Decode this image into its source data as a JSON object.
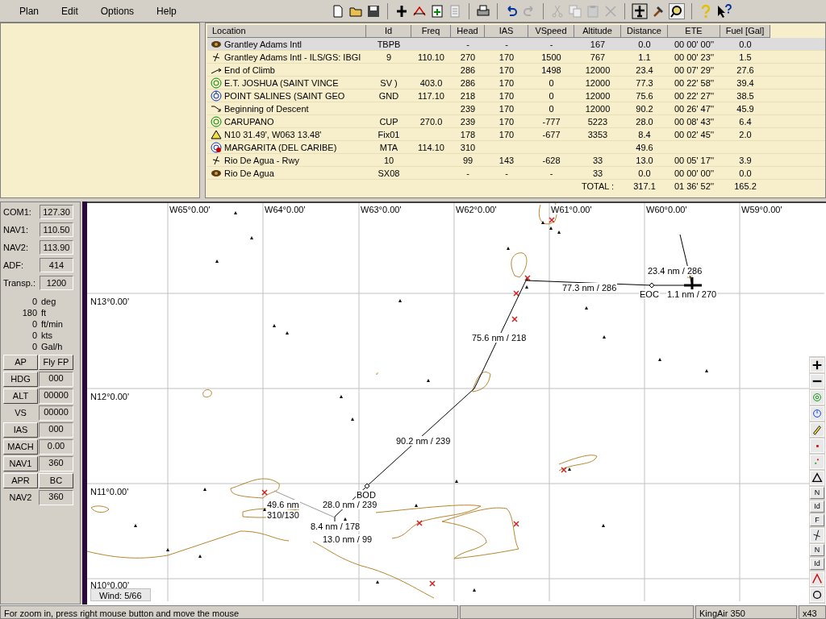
{
  "menu": [
    "Plan",
    "Edit",
    "Options",
    "Help"
  ],
  "flight_plan": {
    "columns": [
      "Location",
      "Id",
      "Freq",
      "Head",
      "IAS",
      "VSpeed",
      "Altitude",
      "Distance",
      "ETE",
      "Fuel [Gal]"
    ],
    "rows": [
      {
        "kind": "airport",
        "selected": true,
        "cells": [
          "Grantley Adams Intl",
          "TBPB",
          "",
          "-",
          "-",
          "-",
          "167",
          "0.0",
          "00 00' 00''",
          "0.0"
        ]
      },
      {
        "kind": "runway",
        "selected": false,
        "cells": [
          "Grantley Adams Intl - ILS/GS: IBGI",
          "9",
          "110.10",
          "270",
          "170",
          "1500",
          "767",
          "1.1",
          "00 00' 23''",
          "1.5"
        ]
      },
      {
        "kind": "climb",
        "selected": false,
        "cells": [
          "End of Climb",
          "",
          "",
          "286",
          "170",
          "1498",
          "12000",
          "23.4",
          "00 07' 29''",
          "27.6"
        ]
      },
      {
        "kind": "ndb",
        "selected": false,
        "cells": [
          "E.T. JOSHUA (SAINT VINCE",
          "SV )",
          "403.0",
          "286",
          "170",
          "0",
          "12000",
          "77.3",
          "00 22' 58''",
          "39.4"
        ]
      },
      {
        "kind": "vor",
        "selected": false,
        "cells": [
          "POINT SALINES (SAINT GEO",
          "GND",
          "117.10",
          "218",
          "170",
          "0",
          "12000",
          "75.6",
          "00 22' 27''",
          "38.5"
        ]
      },
      {
        "kind": "descent",
        "selected": false,
        "cells": [
          "Beginning of Descent",
          "",
          "",
          "239",
          "170",
          "0",
          "12000",
          "90.2",
          "00 26' 47''",
          "45.9"
        ]
      },
      {
        "kind": "ndb",
        "selected": false,
        "cells": [
          "CARUPANO",
          "CUP",
          "270.0",
          "239",
          "170",
          "-777",
          "5223",
          "28.0",
          "00 08' 43''",
          "6.4"
        ]
      },
      {
        "kind": "fix",
        "selected": false,
        "cells": [
          "N10 31.49', W063 13.48'",
          "Fix01",
          "",
          "178",
          "170",
          "-677",
          "3353",
          "8.4",
          "00 02' 45''",
          "2.0"
        ]
      },
      {
        "kind": "vordme",
        "selected": false,
        "cells": [
          "MARGARITA (DEL CARIBE)",
          "MTA",
          "114.10",
          "310",
          "",
          "",
          "",
          "49.6",
          "",
          ""
        ]
      },
      {
        "kind": "runway",
        "selected": false,
        "cells": [
          "Rio De Agua - Rwy",
          "10",
          "",
          "99",
          "143",
          "-628",
          "33",
          "13.0",
          "00 05' 17''",
          "3.9"
        ]
      },
      {
        "kind": "airport",
        "selected": false,
        "cells": [
          "Rio De Agua",
          "SX08",
          "",
          "-",
          "-",
          "-",
          "33",
          "0.0",
          "00 00' 00''",
          "0.0"
        ]
      }
    ],
    "total": {
      "label": "TOTAL :",
      "distance": "317.1",
      "ete": "01 36' 52''",
      "fuel": "165.2"
    }
  },
  "radios": [
    {
      "label": "COM1:",
      "value": "127.30"
    },
    {
      "label": "NAV1:",
      "value": "110.50"
    },
    {
      "label": "NAV2:",
      "value": "113.90"
    },
    {
      "label": "ADF:",
      "value": "414"
    },
    {
      "label": "Transp.:",
      "value": "1200"
    }
  ],
  "readouts": [
    {
      "value": "0",
      "unit": "deg"
    },
    {
      "value": "180",
      "unit": "ft"
    },
    {
      "value": "0",
      "unit": "ft/min"
    },
    {
      "value": "0",
      "unit": "kts"
    },
    {
      "value": "0",
      "unit": "Gal/h"
    }
  ],
  "autopilot": [
    [
      {
        "kind": "button",
        "text": "AP"
      },
      {
        "kind": "button",
        "text": "Fly FP"
      }
    ],
    [
      {
        "kind": "button",
        "text": "HDG"
      },
      {
        "kind": "field",
        "text": "000"
      }
    ],
    [
      {
        "kind": "button",
        "text": "ALT"
      },
      {
        "kind": "field",
        "text": "00000"
      }
    ],
    [
      {
        "kind": "label",
        "text": "VS"
      },
      {
        "kind": "field",
        "text": "00000"
      }
    ],
    [
      {
        "kind": "button",
        "text": "IAS"
      },
      {
        "kind": "field",
        "text": "000"
      }
    ],
    [
      {
        "kind": "button",
        "text": "MACH"
      },
      {
        "kind": "field",
        "text": "0.00"
      }
    ],
    [
      {
        "kind": "button",
        "text": "NAV1"
      },
      {
        "kind": "field",
        "text": "360"
      }
    ],
    [
      {
        "kind": "button",
        "text": "APR"
      },
      {
        "kind": "button",
        "text": "BC"
      }
    ],
    [
      {
        "kind": "label",
        "text": "NAV2"
      },
      {
        "kind": "field",
        "text": "360"
      }
    ]
  ],
  "map": {
    "longitude_labels": [
      "W65°0.00'",
      "W64°0.00'",
      "W63°0.00'",
      "W62°0.00'",
      "W61°0.00'",
      "W60°0.00'",
      "W59°0.00'"
    ],
    "latitude_labels": [
      "N13°0.00'",
      "N12°0.00'",
      "N11°0.00'",
      "N10°0.00'"
    ],
    "leg_labels": [
      "23.4 nm / 286",
      "77.3 nm / 286",
      "75.6 nm / 218",
      "90.2 nm / 239",
      "28.0 nm / 239",
      "49.6 nm",
      "310/130",
      "8.4 nm / 178",
      "13.0 nm / 99",
      "1.1 nm / 270"
    ],
    "waypoint_labels": [
      "EOC",
      "BOD"
    ],
    "wind": "Wind: 5/66",
    "tool_labels": [
      "N",
      "Id",
      "F",
      "N",
      "Id"
    ]
  },
  "status_bar": {
    "hint": "For zoom in, press right mouse button and move the mouse",
    "aircraft": "KingAir 350",
    "zoom": "x43"
  }
}
